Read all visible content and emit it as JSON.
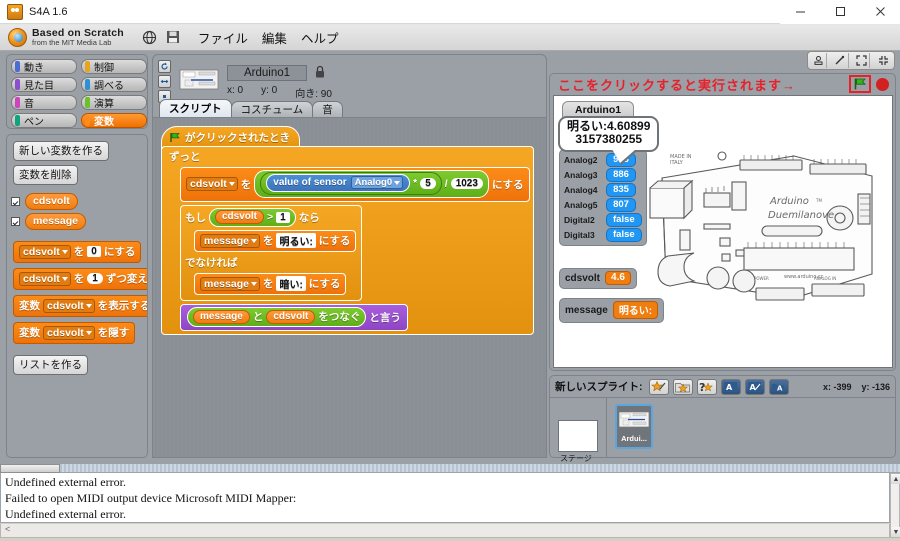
{
  "window": {
    "title": "S4A 1.6",
    "minimize": "minimize-icon",
    "maximize": "maximize-icon",
    "close": "close-icon"
  },
  "menubar": {
    "logo_line1": "Based on Scratch",
    "logo_line2": "from the MIT Media Lab",
    "globe_icon": "globe-icon",
    "save_icon": "save-icon",
    "menus": [
      "ファイル",
      "編集",
      "ヘルプ"
    ]
  },
  "palette": {
    "categories": [
      {
        "label": "動き",
        "color": "#4b6cd4",
        "selected": false
      },
      {
        "label": "制御",
        "color": "#e8a51c",
        "selected": false
      },
      {
        "label": "見た目",
        "color": "#8b4fd0",
        "selected": false
      },
      {
        "label": "調べる",
        "color": "#2f8fd4",
        "selected": false
      },
      {
        "label": "音",
        "color": "#cc44c0",
        "selected": false
      },
      {
        "label": "演算",
        "color": "#6cc02a",
        "selected": false
      },
      {
        "label": "ペン",
        "color": "#12a37e",
        "selected": false
      },
      {
        "label": "変数",
        "color": "#f08000",
        "selected": true
      }
    ],
    "buttons": {
      "make_variable": "新しい変数を作る",
      "delete_variable": "変数を削除",
      "make_list": "リストを作る"
    },
    "variables": [
      {
        "name": "cdsvolt",
        "checked": true
      },
      {
        "name": "message",
        "checked": true
      }
    ],
    "blocks": [
      {
        "prefix": "",
        "var": "cdsvolt",
        "mid": "を",
        "value": "0",
        "suffix": "にする",
        "field": "square"
      },
      {
        "prefix": "",
        "var": "cdsvolt",
        "mid": "を",
        "value": "1",
        "suffix": "ずつ変える",
        "field": "round"
      },
      {
        "prefix": "変数",
        "var": "cdsvolt",
        "mid": "",
        "value": "",
        "suffix": "を表示する",
        "field": "none"
      },
      {
        "prefix": "変数",
        "var": "cdsvolt",
        "mid": "",
        "value": "",
        "suffix": "を隠す",
        "field": "none"
      }
    ]
  },
  "sprite_header": {
    "name": "Arduino1",
    "x_label": "x: 0",
    "y_label": "y: 0",
    "direction_label": "向き: 90",
    "lock_icon": "lock-icon",
    "rotation_buttons": [
      "rotate-icon",
      "flip-icon",
      "no-rotate-icon"
    ],
    "tabs": [
      {
        "label": "スクリプト",
        "active": true
      },
      {
        "label": "コスチューム",
        "active": false
      },
      {
        "label": "音",
        "active": false
      }
    ]
  },
  "script": {
    "hat": {
      "flag_icon": "green-flag-icon",
      "label": "がクリックされたとき"
    },
    "forever_label": "ずっと",
    "set_block": {
      "var": "cdsvolt",
      "wo": "を",
      "sensor_label": "value of sensor",
      "sensor_pin": "Analog0",
      "op_mult": "*",
      "mult_value": "5",
      "op_div": "/",
      "div_value": "1023",
      "suffix": "にする"
    },
    "if_block": {
      "moshi": "もし",
      "var": "cdsvolt",
      "operator": ">",
      "value": "1",
      "nara": "なら",
      "then_set": {
        "var": "message",
        "wo": "を",
        "value": "明るい:",
        "suffix": "にする"
      },
      "else_label": "でなければ",
      "else_set": {
        "var": "message",
        "wo": "を",
        "value": "暗い:",
        "suffix": "にする"
      }
    },
    "say_block": {
      "var_a": "message",
      "to": "と",
      "var_b": "cdsvolt",
      "join": "をつなぐ",
      "suffix": "と言う"
    }
  },
  "stage": {
    "toolbar_buttons": [
      "stamp-icon",
      "wand-icon",
      "expand-icon",
      "shrink-icon"
    ],
    "annotation": "ここをクリックすると実行されます→",
    "green_flag_icon": "green-flag-icon",
    "stop_icon": "stop-sign-icon",
    "sprite_label": "Arduino1",
    "bubble_line1": "明るい:4.60899",
    "bubble_line2": "3157380255",
    "sensor_watchers": [
      {
        "name": "Analog2",
        "value": "913"
      },
      {
        "name": "Analog3",
        "value": "886"
      },
      {
        "name": "Analog4",
        "value": "835"
      },
      {
        "name": "Analog5",
        "value": "807"
      },
      {
        "name": "Digital2",
        "value": "false"
      },
      {
        "name": "Digital3",
        "value": "false"
      }
    ],
    "variable_watchers": [
      {
        "name": "cdsvolt",
        "value": "4.6"
      },
      {
        "name": "message",
        "value": "明るい:"
      }
    ],
    "board_caption": "Arduino Duemilanove"
  },
  "sprite_pane": {
    "new_sprite_label": "新しいスプライト:",
    "new_sprite_buttons": [
      "paint-new-sprite-icon",
      "open-sprite-folder-icon",
      "surprise-sprite-icon",
      "import-a-icon",
      "edit-a-icon",
      "export-sprite-icon"
    ],
    "mouse_x": "x: -399",
    "mouse_y": "y: -136",
    "stage_caption": "ステージ",
    "sprites": [
      {
        "name": "Ardui..."
      }
    ]
  },
  "console": {
    "lines": [
      "Undefined external error.",
      "Failed to open MIDI output device Microsoft MIDI Mapper:",
      "Undefined external error."
    ],
    "status_marker": "<"
  }
}
